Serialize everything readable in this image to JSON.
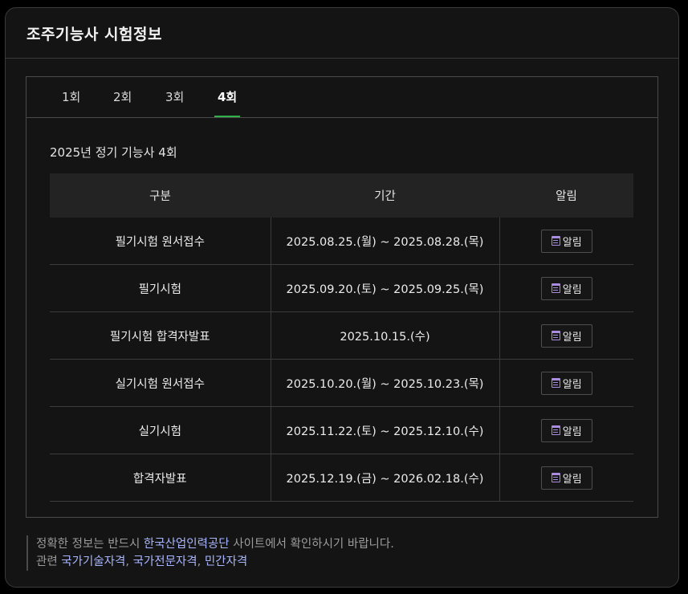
{
  "header": {
    "title": "조주기능사 시험정보"
  },
  "tabs": [
    {
      "label": "1회",
      "active": false
    },
    {
      "label": "2회",
      "active": false
    },
    {
      "label": "3회",
      "active": false
    },
    {
      "label": "4회",
      "active": true
    }
  ],
  "round_title": "2025년 정기 기능사 4회",
  "table": {
    "headers": [
      "구분",
      "기간",
      "알림"
    ],
    "rows": [
      {
        "category": "필기시험 원서접수",
        "period": "2025.08.25.(월) ~ 2025.08.28.(목)",
        "alarm": "알림"
      },
      {
        "category": "필기시험",
        "period": "2025.09.20.(토) ~ 2025.09.25.(목)",
        "alarm": "알림"
      },
      {
        "category": "필기시험 합격자발표",
        "period": "2025.10.15.(수)",
        "alarm": "알림"
      },
      {
        "category": "실기시험 원서접수",
        "period": "2025.10.20.(월) ~ 2025.10.23.(목)",
        "alarm": "알림"
      },
      {
        "category": "실기시험",
        "period": "2025.11.22.(토) ~ 2025.12.10.(수)",
        "alarm": "알림"
      },
      {
        "category": "합격자발표",
        "period": "2025.12.19.(금) ~ 2026.02.18.(수)",
        "alarm": "알림"
      }
    ]
  },
  "footer": {
    "line1_prefix": "정확한 정보는 반드시",
    "line1_link": "한국산업인력공단",
    "line1_suffix": "사이트에서 확인하시기 바랍니다.",
    "line2_prefix": "관련",
    "links": [
      "국가기술자격",
      "국가전문자격",
      "민간자격"
    ],
    "separator": ", "
  },
  "colors": {
    "accent_tab": "#2fb14a",
    "link": "#a9b6ff",
    "calendar_icon": "#a98be0"
  },
  "icons": {
    "alarm": "calendar-icon"
  }
}
